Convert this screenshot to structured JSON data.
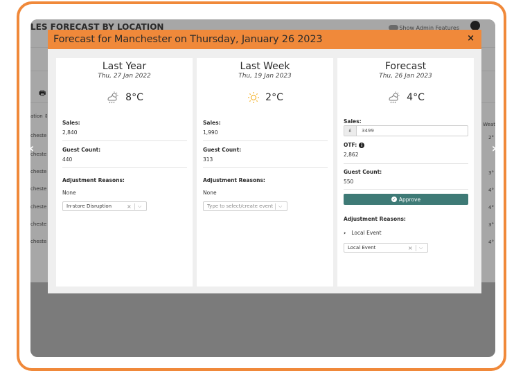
{
  "background": {
    "title": "LES FORECAST BY LOCATION",
    "admin_label": "Show Admin Features",
    "col_head": "ation ↕",
    "weather_head": "Weat",
    "rows_left": [
      "cheste",
      "cheste",
      "cheste",
      "cheste",
      "cheste",
      "cheste",
      "cheste"
    ],
    "rows_right": [
      "2°",
      "",
      "3°",
      "4°",
      "4°",
      "3°",
      "4°"
    ]
  },
  "modal": {
    "title": "Forecast for Manchester on Thursday, January 26 2023",
    "close": "×"
  },
  "cards": {
    "last_year": {
      "title": "Last Year",
      "date": "Thu, 27 Jan 2022",
      "temp": "8°C",
      "weather_icon": "cloud-rain-sun-icon",
      "sales_label": "Sales:",
      "sales_value": "2,840",
      "guest_label": "Guest Count:",
      "guest_value": "440",
      "reasons_label": "Adjustment Reasons:",
      "reasons_value": "None",
      "select_value": "In-store Disruption"
    },
    "last_week": {
      "title": "Last Week",
      "date": "Thu, 19 Jan 2023",
      "temp": "2°C",
      "weather_icon": "sun-icon",
      "sales_label": "Sales:",
      "sales_value": "1,990",
      "guest_label": "Guest Count:",
      "guest_value": "313",
      "reasons_label": "Adjustment Reasons:",
      "reasons_value": "None",
      "select_placeholder": "Type to select/create event"
    },
    "forecast": {
      "title": "Forecast",
      "date": "Thu, 26 Jan 2023",
      "temp": "4°C",
      "weather_icon": "cloud-rain-sun-icon",
      "sales_label": "Sales:",
      "currency": "£",
      "sales_input": "3499",
      "otf_label": "OTF:",
      "otf_value": "2,862",
      "guest_label": "Guest Count:",
      "guest_value": "550",
      "approve_label": "Approve",
      "reasons_label": "Adjustment Reasons:",
      "reason_item": "Local Event",
      "select_value": "Local Event"
    }
  },
  "colors": {
    "accent": "#f0893a",
    "approve": "#3e7a76",
    "sun": "#f5b83a"
  }
}
